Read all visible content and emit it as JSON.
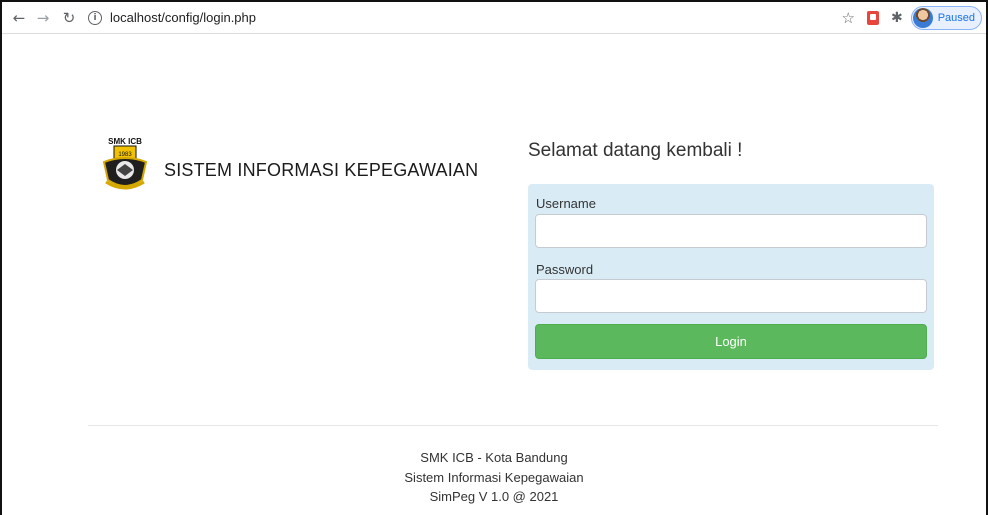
{
  "browser": {
    "url": "localhost/config/login.php",
    "profile_status": "Paused",
    "icons": {
      "back": "back-arrow-icon",
      "forward": "forward-arrow-icon",
      "reload": "reload-icon",
      "site_info": "info-icon",
      "bookmark": "star-icon",
      "extension": "extension-icon",
      "extensions_menu": "puzzle-icon"
    }
  },
  "brand": {
    "logo_text": "SMK ICB",
    "logo_year": "1983",
    "title": "SISTEM INFORMASI KEPEGAWAIAN"
  },
  "login": {
    "welcome": "Selamat datang kembali !",
    "username_label": "Username",
    "username_value": "",
    "password_label": "Password",
    "password_value": "",
    "button_label": "Login"
  },
  "footer": {
    "line1": "SMK ICB - Kota Bandung",
    "line2": "Sistem Informasi Kepegawaian",
    "line3": "SimPeg V 1.0 @ 2021"
  },
  "colors": {
    "login_box_bg": "#d9ecf6",
    "login_button": "#5cb85c",
    "accent_blue": "#1a73e8"
  }
}
